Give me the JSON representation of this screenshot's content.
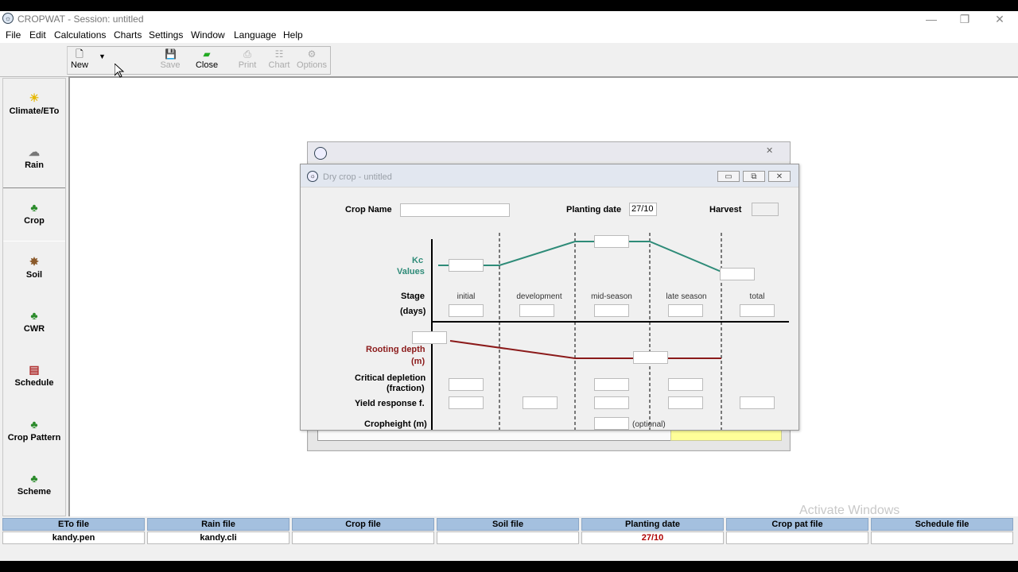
{
  "window": {
    "title": "CROPWAT - Session: untitled",
    "minimize": "—",
    "restore": "❐",
    "close": "✕"
  },
  "menu": [
    "File",
    "Edit",
    "Calculations",
    "Charts",
    "Settings",
    "Window",
    "Language",
    "Help"
  ],
  "toolbar": {
    "new": "New",
    "save": "Save",
    "close": "Close",
    "print": "Print",
    "chart": "Chart",
    "options": "Options"
  },
  "sidebar": [
    "Climate/ETo",
    "Rain",
    "Crop",
    "Soil",
    "CWR",
    "Schedule",
    "Crop Pattern",
    "Scheme"
  ],
  "dialog": {
    "title": "Dry crop - untitled",
    "crop_name_label": "Crop Name",
    "crop_name_value": "",
    "planting_date_label": "Planting date",
    "planting_date_value": "27/10",
    "harvest_label": "Harvest",
    "kc_label_1": "Kc",
    "kc_label_2": "Values",
    "stage_label": "Stage",
    "days_label": "(days)",
    "stages": [
      "initial",
      "development",
      "mid-season",
      "late season",
      "total"
    ],
    "rooting_label_1": "Rooting depth",
    "rooting_label_2": "(m)",
    "critical_label_1": "Critical depletion",
    "critical_label_2": "(fraction)",
    "yield_label": "Yield response f.",
    "cropheight_label": "Cropheight (m)",
    "optional": "(optional)"
  },
  "status": {
    "headers": [
      "ETo file",
      "Rain file",
      "Crop file",
      "Soil file",
      "Planting date",
      "Crop pat file",
      "Schedule file"
    ],
    "values": [
      "kandy.pen",
      "kandy.cli",
      "",
      "",
      "27/10",
      "",
      ""
    ]
  },
  "watermark": "Activate Windows",
  "colors": {
    "kc_line": "#2e8b78",
    "root_line": "#8b1a1a",
    "header_blue": "#a4c0df",
    "planting_red": "#b00000"
  }
}
